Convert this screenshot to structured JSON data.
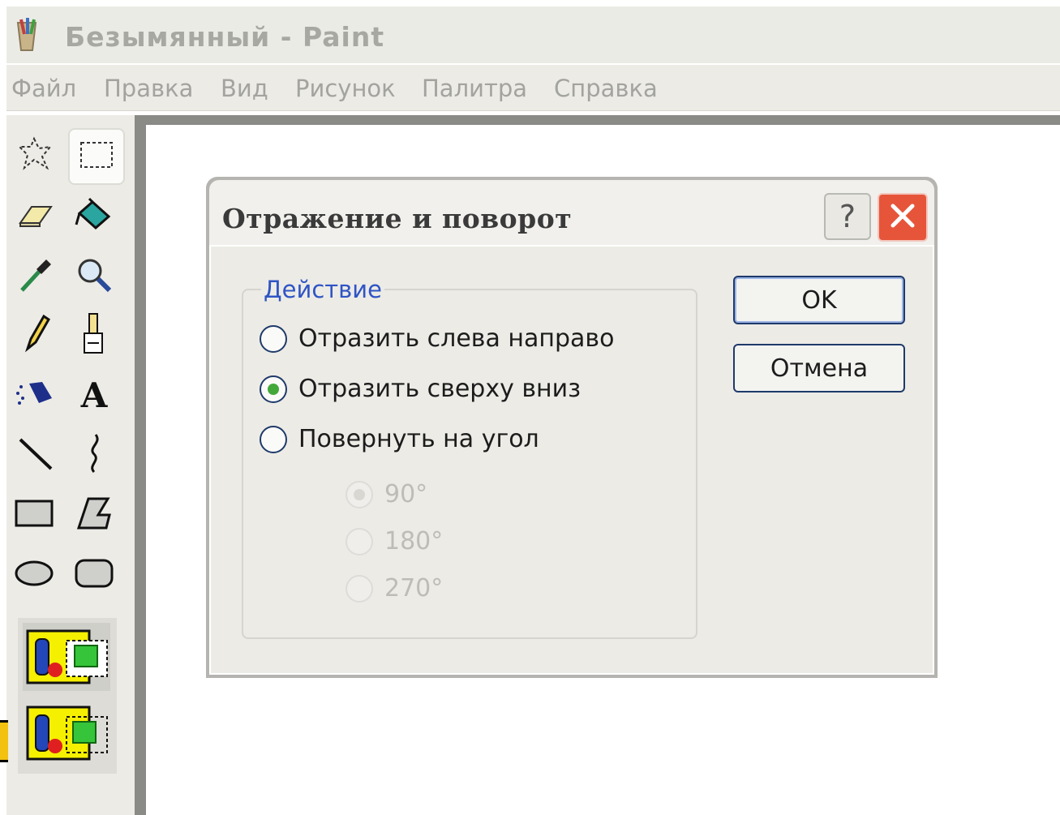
{
  "window": {
    "title": "Безымянный - Paint",
    "icon": "paint-app-icon"
  },
  "menu": {
    "items": [
      "Файл",
      "Правка",
      "Вид",
      "Рисунок",
      "Палитра",
      "Справка"
    ]
  },
  "toolbox": {
    "tools": [
      {
        "name": "free-form-select",
        "icon": "free-select-icon",
        "selected": false
      },
      {
        "name": "rect-select",
        "icon": "rect-select-icon",
        "selected": true
      },
      {
        "name": "eraser",
        "icon": "eraser-icon",
        "selected": false
      },
      {
        "name": "fill",
        "icon": "fill-bucket-icon",
        "selected": false
      },
      {
        "name": "pick-color",
        "icon": "eyedropper-icon",
        "selected": false
      },
      {
        "name": "magnifier",
        "icon": "magnifier-icon",
        "selected": false
      },
      {
        "name": "pencil",
        "icon": "pencil-icon",
        "selected": false
      },
      {
        "name": "brush",
        "icon": "brush-icon",
        "selected": false
      },
      {
        "name": "airbrush",
        "icon": "airbrush-icon",
        "selected": false
      },
      {
        "name": "text",
        "icon": "text-icon",
        "label": "A",
        "selected": false
      },
      {
        "name": "line",
        "icon": "line-icon",
        "selected": false
      },
      {
        "name": "curve",
        "icon": "curve-icon",
        "selected": false
      },
      {
        "name": "rectangle",
        "icon": "rectangle-icon",
        "selected": false
      },
      {
        "name": "polygon",
        "icon": "polygon-icon",
        "selected": false
      },
      {
        "name": "ellipse",
        "icon": "ellipse-icon",
        "selected": false
      },
      {
        "name": "rounded-rectangle",
        "icon": "rounded-rect-icon",
        "selected": false
      }
    ],
    "transparency_options": [
      "opaque-selection-icon",
      "transparent-selection-icon"
    ]
  },
  "dialog": {
    "title": "Отражение и поворот",
    "help_label": "?",
    "group_label": "Действие",
    "options": [
      {
        "label": "Отразить слева направо",
        "checked": false
      },
      {
        "label": "Отразить сверху вниз",
        "checked": true
      },
      {
        "label": "Повернуть на угол",
        "checked": false
      }
    ],
    "angles": [
      {
        "label": "90°",
        "checked": true,
        "disabled": true
      },
      {
        "label": "180°",
        "checked": false,
        "disabled": true
      },
      {
        "label": "270°",
        "checked": false,
        "disabled": true
      }
    ],
    "ok_label": "OK",
    "cancel_label": "Отмена"
  },
  "colors": {
    "accent": "#2f54c4",
    "close_button": "#e6553a",
    "radio_checked": "#43a83a"
  }
}
